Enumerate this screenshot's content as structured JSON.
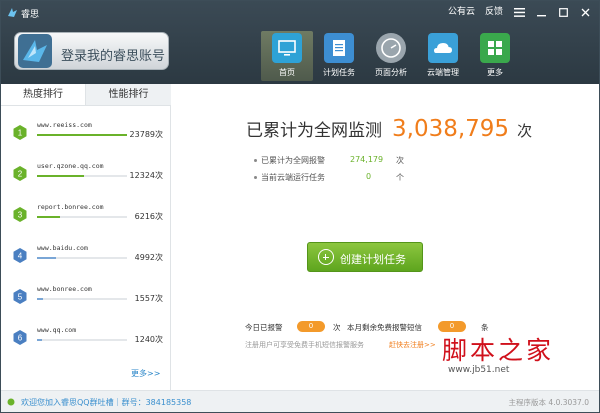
{
  "window": {
    "title": "睿思",
    "controls": {
      "cloud": "公有云",
      "feedback": "反馈",
      "menu_icon": "menu-icon",
      "minimize_icon": "minimize-icon",
      "maximize_icon": "maximize-icon",
      "close_icon": "close-icon"
    }
  },
  "header": {
    "login_label": "登录我的睿思账号",
    "nav": [
      {
        "label": "首页",
        "icon": "monitor-icon",
        "color": "#2ea2d6",
        "active": true
      },
      {
        "label": "计划任务",
        "icon": "clipboard-icon",
        "color": "#3d8ed2",
        "active": false
      },
      {
        "label": "页面分析",
        "icon": "gauge-icon",
        "color": "#9aa5ad",
        "active": false
      },
      {
        "label": "云端管理",
        "icon": "cloud-icon",
        "color": "#3aa0d8",
        "active": false
      },
      {
        "label": "更多",
        "icon": "grid-icon",
        "color": "#3aa84c",
        "active": false
      }
    ]
  },
  "sidebar": {
    "tabs": [
      {
        "label": "热度排行",
        "active": true
      },
      {
        "label": "性能排行",
        "active": false
      }
    ],
    "items": [
      {
        "rank": "1",
        "domain": "www.reeiss.com",
        "count": "23789次",
        "progress": 1.0,
        "color": "#6ab22a"
      },
      {
        "rank": "2",
        "domain": "user.qzone.qq.com",
        "count": "12324次",
        "progress": 0.52,
        "color": "#6ab22a"
      },
      {
        "rank": "3",
        "domain": "report.bonree.com",
        "count": "6216次",
        "progress": 0.26,
        "color": "#6ab22a"
      },
      {
        "rank": "4",
        "domain": "www.baidu.com",
        "count": "4992次",
        "progress": 0.21,
        "color": "#7aa6d6"
      },
      {
        "rank": "5",
        "domain": "www.bonree.com",
        "count": "1557次",
        "progress": 0.07,
        "color": "#7aa6d6"
      },
      {
        "rank": "6",
        "domain": "www.qq.com",
        "count": "1240次",
        "progress": 0.05,
        "color": "#7aa6d6"
      }
    ],
    "more_link": "更多>>"
  },
  "main": {
    "total_label": "已累计为全网监测",
    "total_value": "3,038,795",
    "total_unit": "次",
    "stats": [
      {
        "label": "已累计为全网报警",
        "value": "274,179",
        "unit": "次"
      },
      {
        "label": "当前云端运行任务",
        "value": "0",
        "unit": "个"
      }
    ],
    "create_button": "创建计划任务",
    "today_alarm_label": "今日已报警",
    "today_alarm_value": "0",
    "today_alarm_unit": "次",
    "sms_label": "本月剩余免费报警短信",
    "sms_value": "0",
    "sms_unit": "条",
    "register_hint": "注册用户可享受免费手机短信报警服务",
    "register_link": "赶快去注册>>"
  },
  "watermark": {
    "text": "脚本之家",
    "url": "www.jb51.net"
  },
  "statusbar": {
    "message": "欢迎您加入睿思QQ群吐槽｜群号：384185358",
    "version": "主程序版本 4.0.3037.0"
  }
}
